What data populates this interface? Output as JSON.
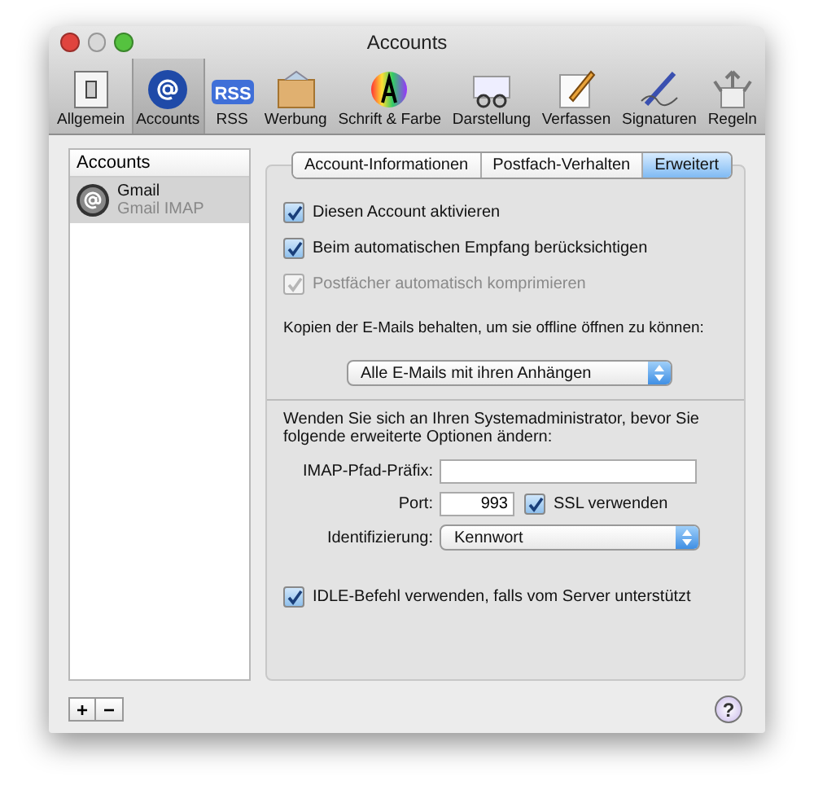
{
  "window": {
    "title": "Accounts"
  },
  "toolbar": [
    {
      "label": "Allgemein",
      "selected": false
    },
    {
      "label": "Accounts",
      "selected": true
    },
    {
      "label": "RSS",
      "selected": false,
      "badge": "RSS"
    },
    {
      "label": "Werbung",
      "selected": false
    },
    {
      "label": "Schrift & Farbe",
      "selected": false
    },
    {
      "label": "Darstellung",
      "selected": false
    },
    {
      "label": "Verfassen",
      "selected": false
    },
    {
      "label": "Signaturen",
      "selected": false
    },
    {
      "label": "Regeln",
      "selected": false
    }
  ],
  "sidebar": {
    "header": "Accounts",
    "items": [
      {
        "name": "Gmail",
        "type": "Gmail IMAP",
        "selected": true
      }
    ]
  },
  "tabs": [
    {
      "label": "Account-Informationen",
      "selected": false
    },
    {
      "label": "Postfach-Verhalten",
      "selected": false
    },
    {
      "label": "Erweitert",
      "selected": true
    }
  ],
  "options": [
    {
      "label": "Diesen Account aktivieren",
      "checked": true,
      "disabled": false
    },
    {
      "label": "Beim automatischen Empfang berücksichtigen",
      "checked": true,
      "disabled": false
    },
    {
      "label": "Postfächer automatisch komprimieren",
      "checked": true,
      "disabled": true
    }
  ],
  "copies": {
    "label": "Kopien der E-Mails behalten, um sie offline öffnen zu können:",
    "value": "Alle E-Mails mit ihren Anhängen"
  },
  "advanced": {
    "note": "Wenden Sie sich an Ihren Systemadministrator, bevor Sie folgende erweiterte Optionen ändern:",
    "prefix_label": "IMAP-Pfad-Präfix:",
    "port_label": "Port:",
    "port_value": "993",
    "ssl": {
      "label": "SSL verwenden",
      "checked": true
    },
    "auth_label": "Identifizierung:",
    "auth_value": "Kennwort",
    "idle": {
      "label": "IDLE-Befehl verwenden, falls vom Server unterstützt",
      "checked": true
    }
  },
  "footer": {
    "add": "+",
    "remove": "−",
    "help": "?"
  }
}
